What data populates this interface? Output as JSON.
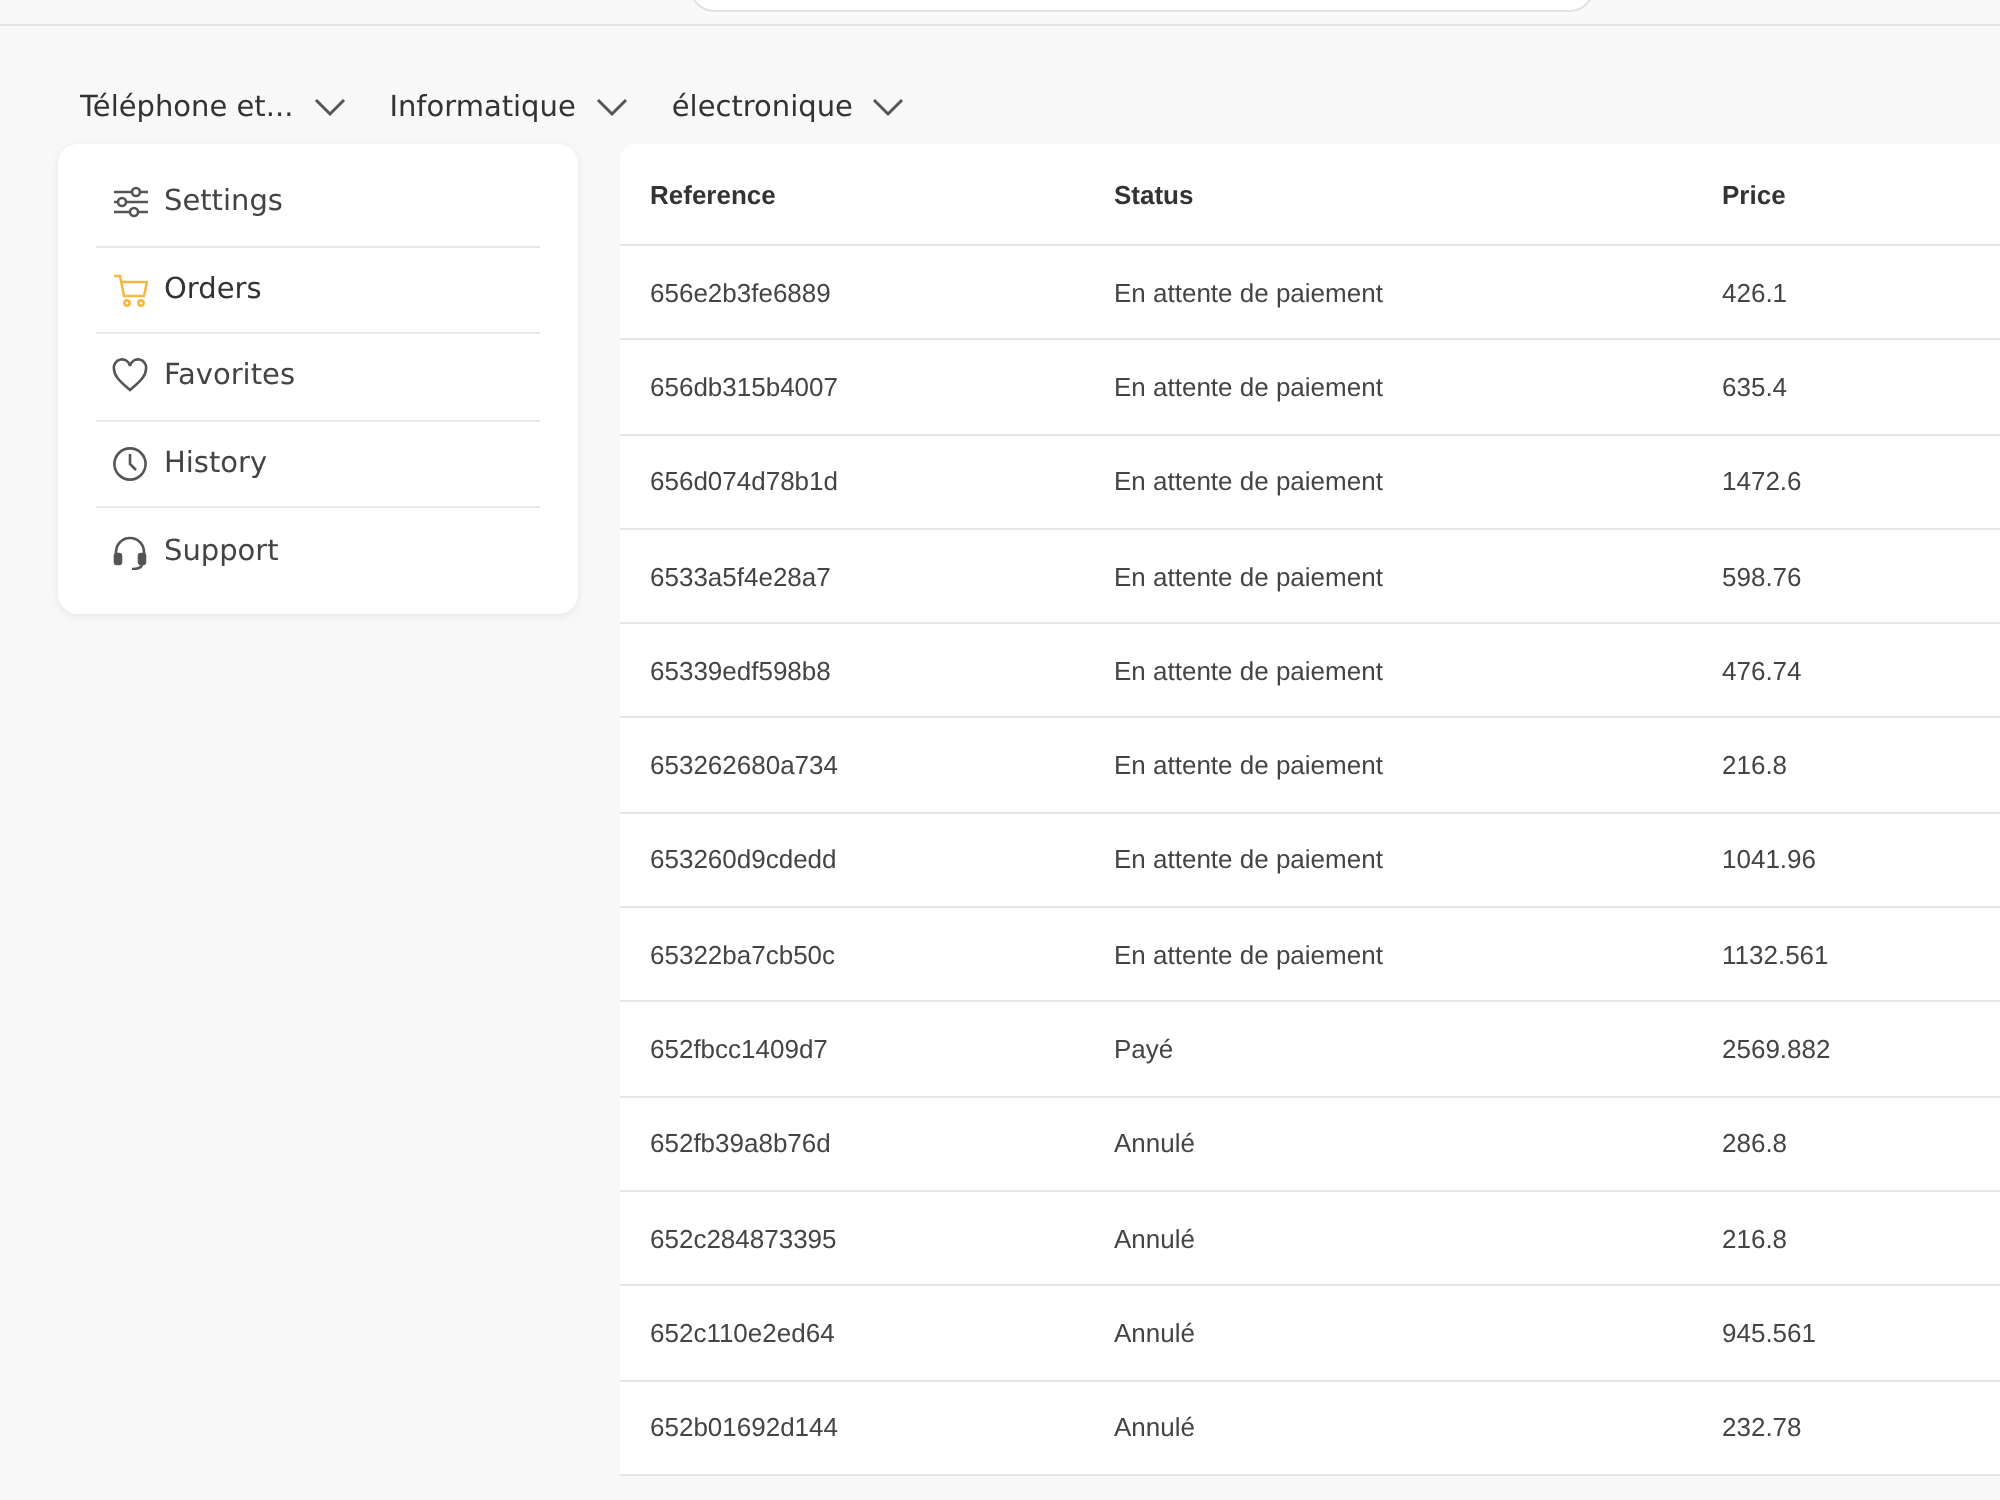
{
  "categories": [
    {
      "label": "Téléphone et..."
    },
    {
      "label": "Informatique"
    },
    {
      "label": "électronique"
    }
  ],
  "sidebar": {
    "items": [
      {
        "label": "Settings",
        "kind": "settings",
        "selected": false
      },
      {
        "label": "Orders",
        "kind": "cart",
        "selected": true
      },
      {
        "label": "Favorites",
        "kind": "heart",
        "selected": false
      },
      {
        "label": "History",
        "kind": "clock",
        "selected": false
      },
      {
        "label": "Support",
        "kind": "headset",
        "selected": false
      }
    ]
  },
  "table": {
    "columns": [
      "Reference",
      "Status",
      "Price"
    ],
    "rows": [
      [
        "656e2b3fe6889",
        "En attente de paiement",
        "426.1"
      ],
      [
        "656db315b4007",
        "En attente de paiement",
        "635.4"
      ],
      [
        "656d074d78b1d",
        "En attente de paiement",
        "1472.6"
      ],
      [
        "6533a5f4e28a7",
        "En attente de paiement",
        "598.76"
      ],
      [
        "65339edf598b8",
        "En attente de paiement",
        "476.74"
      ],
      [
        "653262680a734",
        "En attente de paiement",
        "216.8"
      ],
      [
        "653260d9cdedd",
        "En attente de paiement",
        "1041.96"
      ],
      [
        "65322ba7cb50c",
        "En attente de paiement",
        "1132.561"
      ],
      [
        "652fbcc1409d7",
        "Payé",
        "2569.882"
      ],
      [
        "652fb39a8b76d",
        "Annulé",
        "286.8"
      ],
      [
        "652c284873395",
        "Annulé",
        "216.8"
      ],
      [
        "652c110e2ed64",
        "Annulé",
        "945.561"
      ],
      [
        "652b01692d144",
        "Annulé",
        "232.78"
      ]
    ]
  }
}
